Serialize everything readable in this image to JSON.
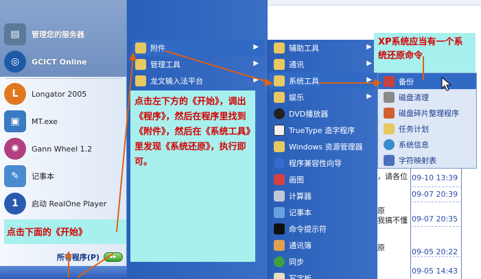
{
  "start_menu": {
    "pinned": [
      {
        "label": "管理您的服务器",
        "icon": "server-icon",
        "color": "#5a7a9a"
      },
      {
        "label": "GCICT Online",
        "icon": "globe-icon",
        "color": "#1e5aa8"
      }
    ],
    "recent": [
      {
        "label": "Longator 2005",
        "icon": "longator-icon",
        "color": "#e07820"
      },
      {
        "label": "MT.exe",
        "icon": "app-icon",
        "color": "#3a7ac0"
      },
      {
        "label": "Gann Wheel 1.2",
        "icon": "wheel-icon",
        "color": "#b04080"
      },
      {
        "label": "记事本",
        "icon": "notepad-icon",
        "color": "#4a8ad0"
      },
      {
        "label": "启动 RealOne Player",
        "icon": "realone-icon",
        "color": "#2a5ab0"
      }
    ],
    "all_programs_label": "所有程序(P)",
    "all_programs_arrow": "▸▸"
  },
  "programs_menu": {
    "items": [
      {
        "label": "附件",
        "icon": "folder-icon",
        "has_sub": true,
        "highlighted": true
      },
      {
        "label": "管理工具",
        "icon": "folder-icon",
        "has_sub": true
      },
      {
        "label": "龙文输入法平台",
        "icon": "folder-icon",
        "has_sub": true
      }
    ]
  },
  "accessories_menu": {
    "items": [
      {
        "label": "辅助工具",
        "icon": "folder-icon",
        "has_sub": true
      },
      {
        "label": "通讯",
        "icon": "folder-icon",
        "has_sub": true
      },
      {
        "label": "系统工具",
        "icon": "folder-icon",
        "has_sub": true,
        "highlighted": true
      },
      {
        "label": "娱乐",
        "icon": "folder-icon",
        "has_sub": true
      },
      {
        "label": "DVD播放器",
        "icon": "dvd-icon"
      },
      {
        "label": "TrueType 造字程序",
        "icon": "font-icon"
      },
      {
        "label": "Windows 资源管理器",
        "icon": "explorer-icon"
      },
      {
        "label": "程序兼容性向导",
        "icon": "help-icon"
      },
      {
        "label": "画图",
        "icon": "paint-icon"
      },
      {
        "label": "计算器",
        "icon": "calculator-icon"
      },
      {
        "label": "记事本",
        "icon": "notepad-icon"
      },
      {
        "label": "命令提示符",
        "icon": "cmd-icon"
      },
      {
        "label": "通讯簿",
        "icon": "addressbook-icon"
      },
      {
        "label": "同步",
        "icon": "sync-icon"
      },
      {
        "label": "写字板",
        "icon": "wordpad-icon"
      }
    ]
  },
  "systools_menu": {
    "items": [
      {
        "label": "备份",
        "icon": "backup-icon",
        "highlighted": true
      },
      {
        "label": "磁盘清理",
        "icon": "diskclean-icon"
      },
      {
        "label": "磁盘碎片整理程序",
        "icon": "defrag-icon"
      },
      {
        "label": "任务计划",
        "icon": "tasks-icon"
      },
      {
        "label": "系统信息",
        "icon": "sysinfo-icon"
      },
      {
        "label": "字符映射表",
        "icon": "charmap-icon"
      }
    ]
  },
  "notes": {
    "right": "XP系统应当有一个系统还原命令",
    "middle": "点击左下方的《开始》，调出《程序》，然后在程序里找到《附件》，然后在《系统工具》里发现《系统还原》，执行即可。",
    "left": "点击下面的《开始》"
  },
  "background_rows": [
    {
      "text": "，请各位",
      "date": ""
    },
    {
      "text": "",
      "date": "09-10 13:39"
    },
    {
      "text": "",
      "date": "09-07 20:39"
    },
    {
      "text": "原",
      "date": ""
    },
    {
      "text": "我搞不懂",
      "date": "09-07 20:35"
    },
    {
      "text": "",
      "date": ""
    },
    {
      "text": "原",
      "date": ""
    },
    {
      "text": "",
      "date": "09-05 20:22"
    },
    {
      "text": "",
      "date": "09-05 14:43"
    }
  ],
  "colors": {
    "accent": "#e06010",
    "note_bg": "#a8f0ee",
    "note_text": "#d40000",
    "menu_blue": "#2a5fb8"
  }
}
